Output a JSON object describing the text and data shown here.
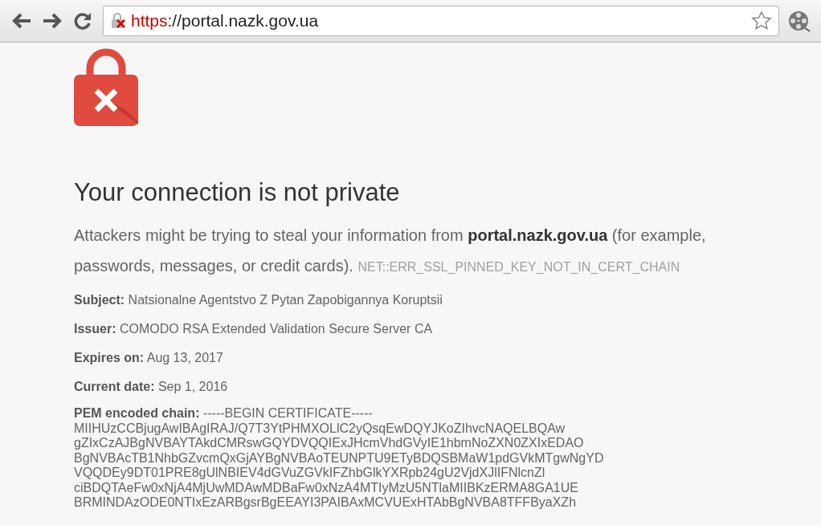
{
  "toolbar": {
    "address": {
      "scheme": "https",
      "scheme_insecure": true,
      "rest": "://portal.nazk.gov.ua"
    }
  },
  "error": {
    "title": "Your connection is not private",
    "message": "Attackers might be trying to steal your information from **portal.nazk.gov.ua** (for example, passwords, messages, or credit cards).",
    "code": "NET::ERR_SSL_PINNED_KEY_NOT_IN_CERT_CHAIN",
    "details": [
      {
        "label": "Subject:",
        "value": "Natsionalne Agentstvo Z Pytan Zapobigannya Koruptsii"
      },
      {
        "label": "Issuer:",
        "value": "COMODO RSA Extended Validation Secure Server CA"
      },
      {
        "label": "Expires on:",
        "value": "Aug 13, 2017"
      },
      {
        "label": "Current date:",
        "value": "Sep 1, 2016"
      }
    ],
    "pem": {
      "label": "PEM encoded chain:",
      "first": "-----BEGIN CERTIFICATE-----",
      "lines": [
        "MIIHUzCCBjugAwIBAgIRAJ/Q7T3YtPHMXOLlC2yQsqEwDQYJKoZIhvcNAQELBQAw",
        "gZIxCzAJBgNVBAYTAkdCMRswGQYDVQQIExJHcmVhdGVyIE1hbmNoZXN0ZXIxEDAO",
        "BgNVBAcTB1NhbGZvcmQxGjAYBgNVBAoTEUNPTU9ETyBDQSBMaW1pdGVkMTgwNgYD",
        "VQQDEy9DT01PRE8gUlNBIEV4dGVuZGVkIFZhbGlkYXRpb24gU2VjdXJlIFNlcnZl",
        "ciBDQTAeFw0xNjA4MjUwMDAwMDBaFw0xNzA4MTIyMzU5NTlaMIIBKzERMA8GA1UE",
        "BRMINDAzODE0NTIxEzARBgsrBgEEAYI3PAIBAxMCVUExHTAbBgNVBA8TFFByaXZh"
      ]
    }
  }
}
